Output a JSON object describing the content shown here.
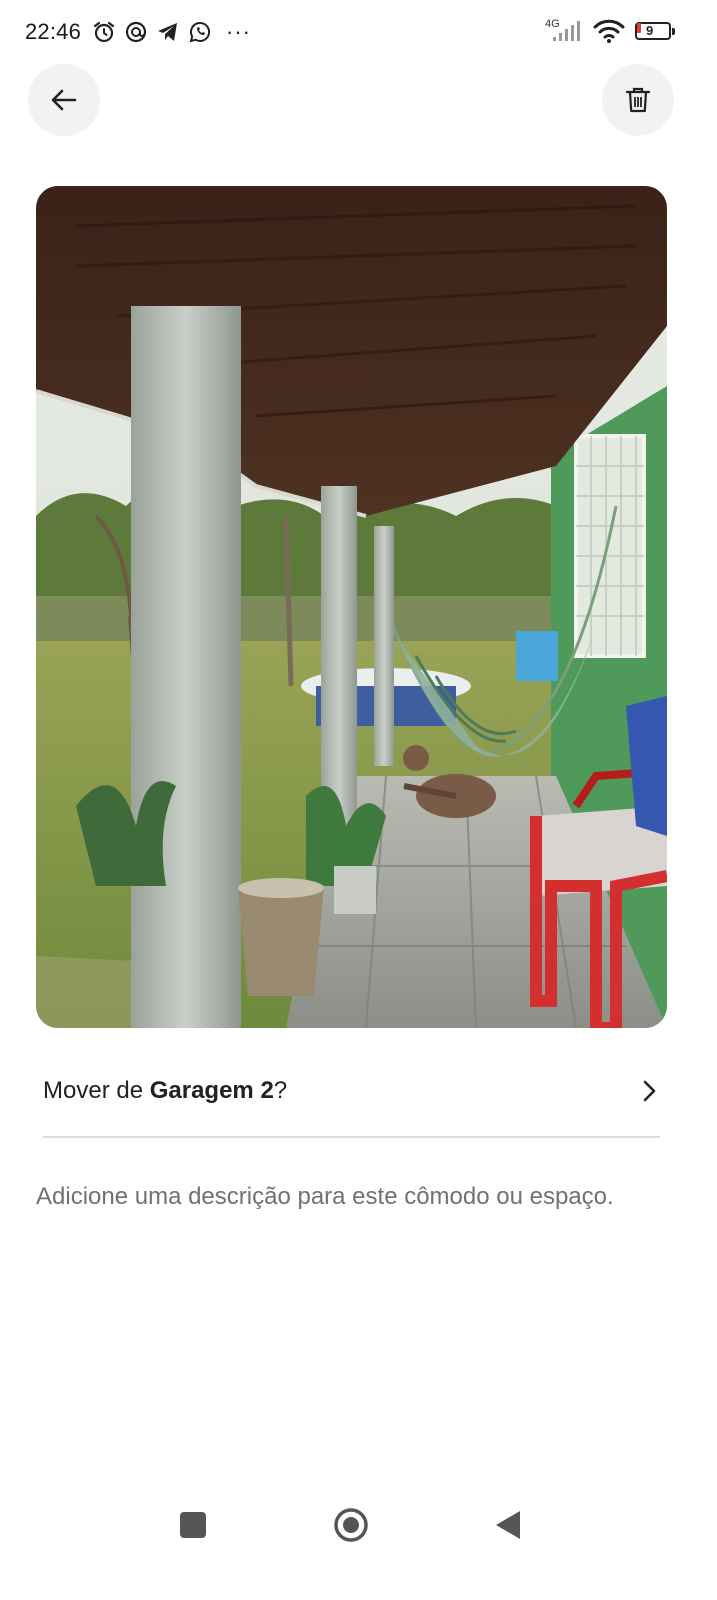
{
  "status_bar": {
    "time": "22:46",
    "left_icons": [
      "alarm-icon",
      "chat-bubble-icon",
      "telegram-icon",
      "whatsapp-icon"
    ],
    "more_indicator": "···",
    "network_type": "4G",
    "battery_level": "9",
    "battery_color": "#e53935"
  },
  "header": {
    "back_icon": "arrow-left-icon",
    "delete_icon": "trash-icon"
  },
  "photo": {
    "subject": "covered-porch-with-hammock-and-dog"
  },
  "move_row": {
    "prefix": "Mover de ",
    "room_name": "Garagem 2",
    "suffix": "?",
    "chevron_icon": "chevron-right-icon"
  },
  "description": {
    "placeholder": "Adicione uma descrição para este cômodo ou espaço."
  },
  "nav_bar": {
    "recents_icon": "square-icon",
    "home_icon": "circle-icon",
    "back_icon": "triangle-back-icon"
  }
}
